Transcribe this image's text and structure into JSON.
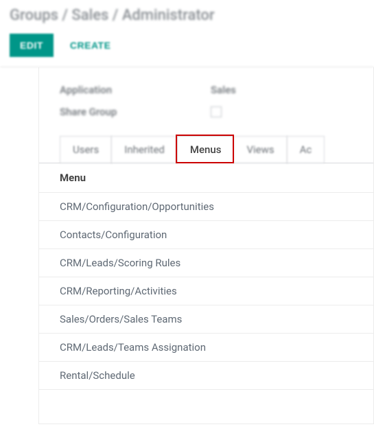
{
  "breadcrumb": "Groups / Sales / Administrator",
  "actions": {
    "edit": "EDIT",
    "create": "CREATE"
  },
  "form": {
    "application_label": "Application",
    "application_value": "Sales",
    "share_group_label": "Share Group"
  },
  "tabs": {
    "items": [
      {
        "id": "users",
        "label": "Users"
      },
      {
        "id": "inherited",
        "label": "Inherited"
      },
      {
        "id": "menus",
        "label": "Menus"
      },
      {
        "id": "views",
        "label": "Views"
      },
      {
        "id": "access",
        "label": "Ac"
      }
    ],
    "active": "menus"
  },
  "table": {
    "header": "Menu",
    "rows": [
      "CRM/Configuration/Opportunities",
      "Contacts/Configuration",
      "CRM/Leads/Scoring Rules",
      "CRM/Reporting/Activities",
      "Sales/Orders/Sales Teams",
      "CRM/Leads/Teams Assignation",
      "Rental/Schedule"
    ]
  }
}
